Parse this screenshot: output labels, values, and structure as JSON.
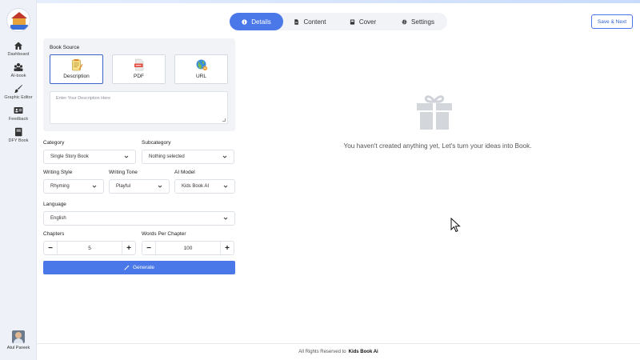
{
  "sidebar": {
    "items": [
      {
        "label": "Dashboard",
        "icon": "home-icon"
      },
      {
        "label": "AI-book",
        "icon": "users-icon"
      },
      {
        "label": "Graphic Editor",
        "icon": "paint-brush-icon"
      },
      {
        "label": "Feedback",
        "icon": "id-card-icon"
      },
      {
        "label": "DFY Book",
        "icon": "book-icon"
      }
    ],
    "user_name": "Atul Pareek"
  },
  "tabs": [
    {
      "label": "Details",
      "icon": "info-icon",
      "active": true
    },
    {
      "label": "Content",
      "icon": "file-icon",
      "active": false
    },
    {
      "label": "Cover",
      "icon": "book-cover-icon",
      "active": false
    },
    {
      "label": "Settings",
      "icon": "gear-icon",
      "active": false
    }
  ],
  "save_button": "Save & Next",
  "book_source": {
    "title": "Book Source",
    "options": [
      {
        "label": "Description",
        "selected": true
      },
      {
        "label": "PDF",
        "selected": false
      },
      {
        "label": "URL",
        "selected": false
      }
    ],
    "description_placeholder": "Enter Your Description Here"
  },
  "form": {
    "category": {
      "label": "Category",
      "value": "Single Story Book"
    },
    "subcategory": {
      "label": "Subcategory",
      "value": "Nothing selected"
    },
    "writing_style": {
      "label": "Writing Style",
      "value": "Rhyming"
    },
    "writing_tone": {
      "label": "Writing Tone",
      "value": "Playful"
    },
    "ai_model": {
      "label": "AI Model",
      "value": "Kids Book AI"
    },
    "language": {
      "label": "Language",
      "value": "English"
    },
    "chapters": {
      "label": "Chapters",
      "value": "5"
    },
    "words_per_chapter": {
      "label": "Words Per Chapter",
      "value": "100"
    },
    "minus": "−",
    "plus": "+"
  },
  "generate_button": "Generate",
  "empty_state": "You haven't created anything yet, Let's turn your ideas into Book.",
  "footer": {
    "text": "All Rights Reserved to",
    "brand": "Kids Book Ai"
  },
  "colors": {
    "accent": "#4a78e8",
    "panel": "#f1f3f6"
  }
}
